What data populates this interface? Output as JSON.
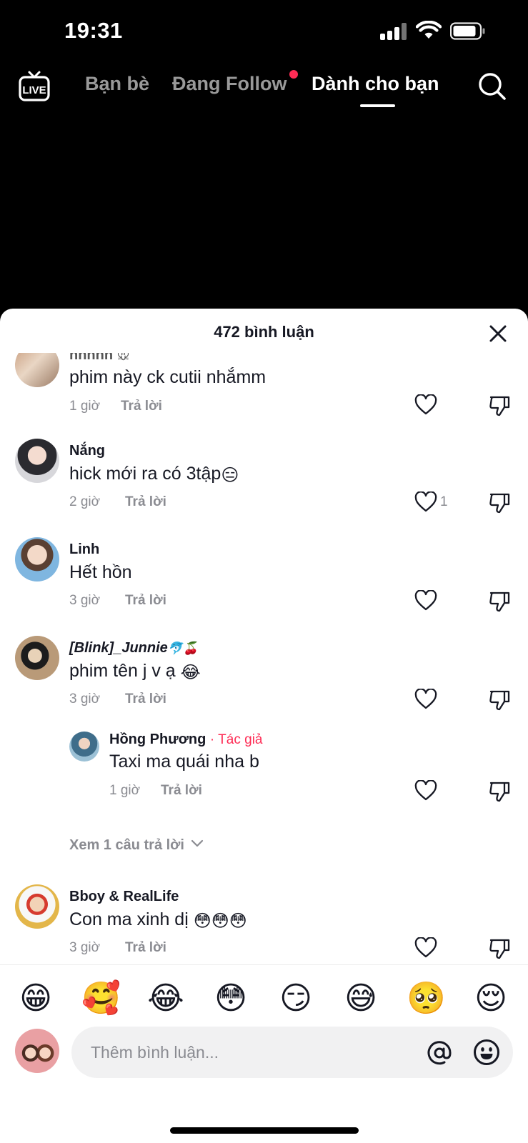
{
  "status_bar": {
    "time": "19:31"
  },
  "nav": {
    "live_label": "LIVE",
    "tabs": [
      {
        "label": "Bạn bè"
      },
      {
        "label": "Đang Follow"
      },
      {
        "label": "Dành cho bạn"
      }
    ],
    "active_tab": "Dành cho bạn",
    "accent_color": "#fe2c55"
  },
  "comments_sheet": {
    "title": "472 bình luận",
    "comments": [
      {
        "user": "nnnnn",
        "user_emoji": "🐭",
        "text": "phim này ck cutii nhắmm",
        "time": "1 giờ",
        "reply_label": "Trả lời",
        "likes": ""
      },
      {
        "user": "Nắng",
        "text": "hick mới ra có 3tập",
        "text_emoji": "😑",
        "time": "2 giờ",
        "reply_label": "Trả lời",
        "likes": "1"
      },
      {
        "user": "Linh",
        "text": "Hết hồn",
        "time": "3 giờ",
        "reply_label": "Trả lời",
        "likes": ""
      },
      {
        "user": "[Blink]_Junnie",
        "user_emoji": "🐬🍒",
        "text": "phim tên j v ạ",
        "text_emoji": "😂",
        "time": "3 giờ",
        "reply_label": "Trả lời",
        "likes": ""
      },
      {
        "user": "Hồng Phương",
        "author_tag": "· Tác giả",
        "text": "Taxi ma quái nha b",
        "time": "1 giờ",
        "reply_label": "Trả lời",
        "likes": "",
        "is_reply": true
      },
      {
        "user": "Bboy & RealLife",
        "text": "Con ma xinh dị",
        "text_emoji": "😳😳😳",
        "time": "3 giờ",
        "reply_label": "Trả lời",
        "likes": ""
      }
    ],
    "view_more_replies": "Xem 1 câu trả lời"
  },
  "emoji_bar": [
    "😁",
    "🥰",
    "😂",
    "😳",
    "😏",
    "😅",
    "🥺",
    "😌"
  ],
  "comment_input": {
    "placeholder": "Thêm bình luận..."
  }
}
